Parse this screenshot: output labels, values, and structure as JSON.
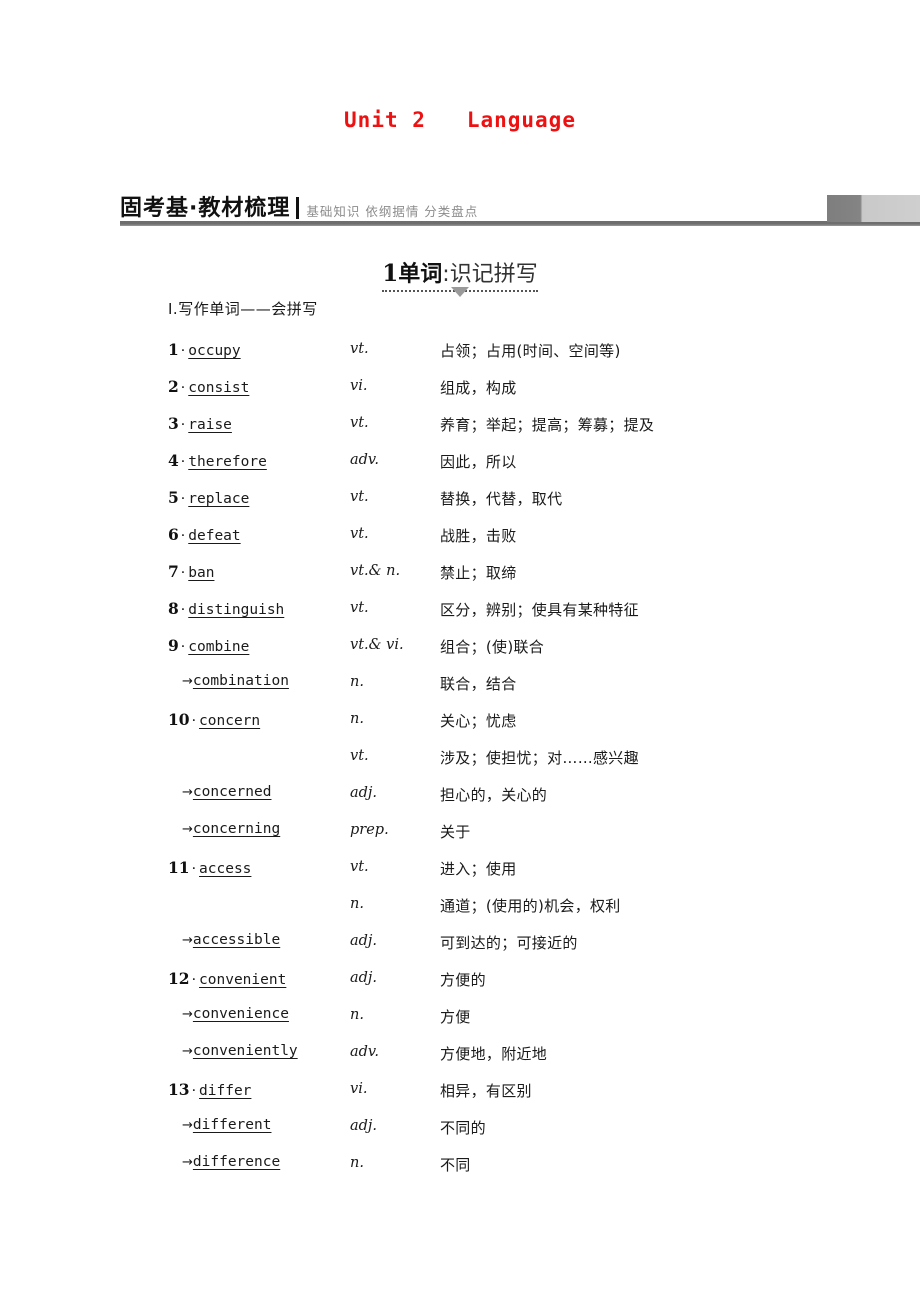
{
  "unit": {
    "title": "Unit 2   Language",
    "title_color": "#ee1111"
  },
  "band": {
    "title": "固考基·教材梳理",
    "subtitle": "基础知识 依纲据情 分类盘点",
    "rule_color": "#6e6e6e",
    "block_dark": "#7e7e7e",
    "block_light": "#cfcfcf"
  },
  "section": {
    "number": "1",
    "strong": "单词",
    "light": ":识记拼写",
    "arrow_icon": "triangle-down-icon"
  },
  "sub_heading": "Ⅰ.写作单词——会拼写",
  "words": [
    {
      "num": "1",
      "dot": "·",
      "term": "occupy",
      "derived": false,
      "pos": "vt.",
      "meaning": "占领；占用(时间、空间等)"
    },
    {
      "num": "2",
      "dot": "·",
      "term": "consist",
      "derived": false,
      "pos": "vi.",
      "meaning": "组成，构成"
    },
    {
      "num": "3",
      "dot": "·",
      "term": "raise",
      "derived": false,
      "pos": "vt.",
      "meaning": "养育；举起；提高；筹募；提及"
    },
    {
      "num": "4",
      "dot": "·",
      "term": "therefore",
      "derived": false,
      "pos": "adv.",
      "meaning": "因此，所以"
    },
    {
      "num": "5",
      "dot": "·",
      "term": "replace",
      "derived": false,
      "pos": "vt.",
      "meaning": "替换，代替，取代"
    },
    {
      "num": "6",
      "dot": "·",
      "term": "defeat",
      "derived": false,
      "pos": "vt.",
      "meaning": "战胜，击败"
    },
    {
      "num": "7",
      "dot": "·",
      "term": "ban",
      "derived": false,
      "pos": "vt.& n.",
      "meaning": "禁止；取缔"
    },
    {
      "num": "8",
      "dot": "·",
      "term": "distinguish",
      "derived": false,
      "pos": "vt.",
      "meaning": "区分，辨别；使具有某种特征"
    },
    {
      "num": "9",
      "dot": "·",
      "term": "combine",
      "derived": false,
      "pos": "vt.& vi.",
      "meaning": "组合；(使)联合"
    },
    {
      "num": "",
      "dot": "",
      "term": "combination",
      "derived": true,
      "pos": "n.",
      "meaning": "联合，结合"
    },
    {
      "num": "10",
      "dot": "·",
      "term": "concern",
      "derived": false,
      "pos": "n.",
      "meaning": "关心；忧虑"
    },
    {
      "num": "",
      "dot": "",
      "term": "",
      "derived": false,
      "pos": "vt.",
      "meaning": "涉及；使担忧；对……感兴趣"
    },
    {
      "num": "",
      "dot": "",
      "term": "concerned",
      "derived": true,
      "pos": "adj.",
      "meaning": "担心的，关心的"
    },
    {
      "num": "",
      "dot": "",
      "term": "concerning",
      "derived": true,
      "pos": "prep.",
      "meaning": "关于"
    },
    {
      "num": "11",
      "dot": "·",
      "term": "access",
      "derived": false,
      "pos": "vt.",
      "meaning": "进入；使用"
    },
    {
      "num": "",
      "dot": "",
      "term": "",
      "derived": false,
      "pos": "n.",
      "meaning": "通道；(使用的)机会，权利"
    },
    {
      "num": "",
      "dot": "",
      "term": "accessible",
      "derived": true,
      "pos": "adj.",
      "meaning": "可到达的；可接近的"
    },
    {
      "num": "12",
      "dot": "·",
      "term": "convenient",
      "derived": false,
      "pos": "adj.",
      "meaning": "方便的"
    },
    {
      "num": "",
      "dot": "",
      "term": "convenience",
      "derived": true,
      "pos": "n.",
      "meaning": "方便"
    },
    {
      "num": "",
      "dot": "",
      "term": "conveniently",
      "derived": true,
      "pos": "adv.",
      "meaning": "方便地，附近地"
    },
    {
      "num": "13",
      "dot": "·",
      "term": "differ",
      "derived": false,
      "pos": "vi.",
      "meaning": "相异，有区别"
    },
    {
      "num": "",
      "dot": "",
      "term": "different",
      "derived": true,
      "pos": "adj.",
      "meaning": "不同的"
    },
    {
      "num": "",
      "dot": "",
      "term": "difference",
      "derived": true,
      "pos": "n.",
      "meaning": "不同"
    }
  ]
}
